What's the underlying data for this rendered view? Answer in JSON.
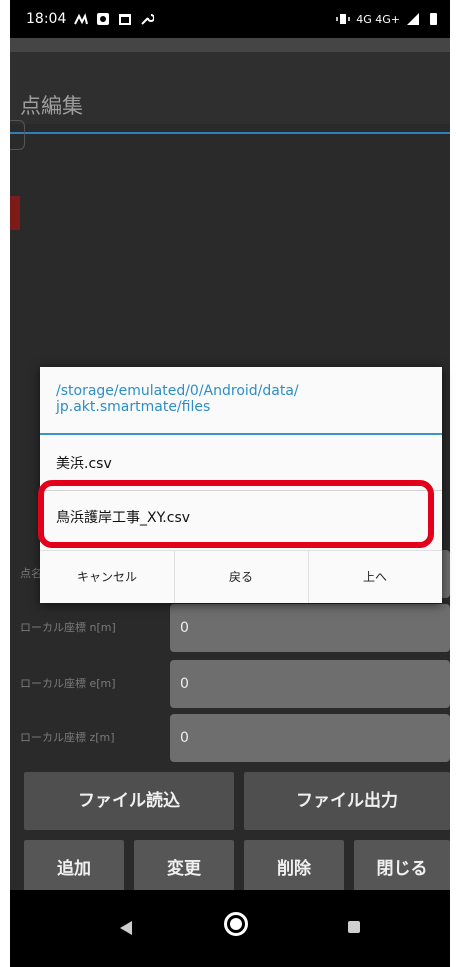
{
  "status_bar": {
    "time": "18:04",
    "network": "4G 4G+"
  },
  "screen": {
    "title": "点編集"
  },
  "form": {
    "rows": [
      {
        "label": "点名",
        "value": ""
      },
      {
        "label": "ローカル座標 n[m]",
        "value": "0"
      },
      {
        "label": "ローカル座標 e[m]",
        "value": "0"
      },
      {
        "label": "ローカル座標 z[m]",
        "value": "0"
      }
    ]
  },
  "buttons": {
    "file_read": "ファイル読込",
    "file_output": "ファイル出力",
    "add": "追加",
    "change": "変更",
    "delete": "削除",
    "close": "閉じる"
  },
  "dialog": {
    "path": "/storage/emulated/0/Android/data/\njp.akt.smartmate/files",
    "files": [
      "美浜.csv",
      "鳥浜護岸工事_XY.csv"
    ],
    "cancel": "キャンセル",
    "back": "戻る",
    "up": "上へ"
  },
  "colors": {
    "accent": "#2f7fba",
    "highlight": "#e3001b"
  }
}
